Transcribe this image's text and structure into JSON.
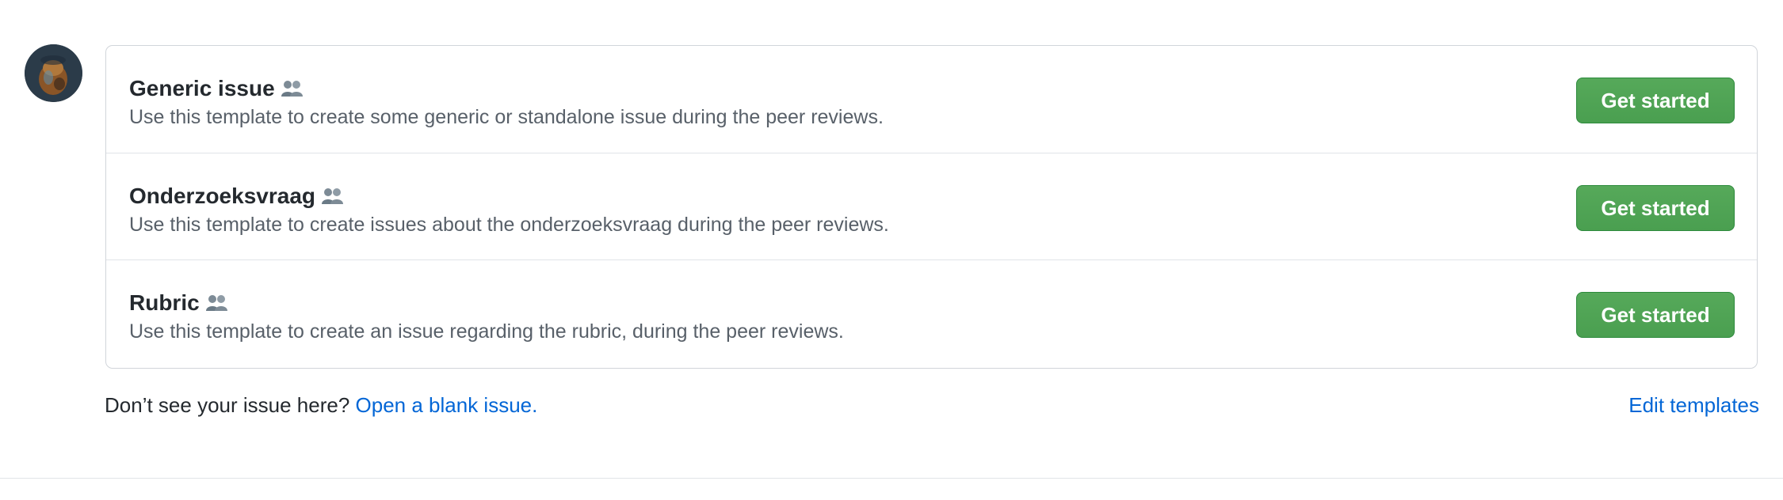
{
  "user": {
    "avatar_icon": "user-avatar"
  },
  "templates": [
    {
      "title": "Generic issue",
      "icon": "people-icon",
      "description": "Use this template to create some generic or standalone issue during the peer reviews.",
      "button_label": "Get started"
    },
    {
      "title": "Onderzoeksvraag",
      "icon": "people-icon",
      "description": "Use this template to create issues about the onderzoeksvraag during the peer reviews.",
      "button_label": "Get started"
    },
    {
      "title": "Rubric",
      "icon": "people-icon",
      "description": "Use this template to create an issue regarding the rubric, during the peer reviews.",
      "button_label": "Get started"
    }
  ],
  "footer": {
    "prompt_text": "Don’t see your issue here?",
    "blank_issue_link": "Open a blank issue.",
    "edit_templates_link": "Edit templates"
  },
  "colors": {
    "button_green": "#4a9f50",
    "link_blue": "#0366d6",
    "muted_text": "#586069",
    "border": "#d1d5da"
  }
}
